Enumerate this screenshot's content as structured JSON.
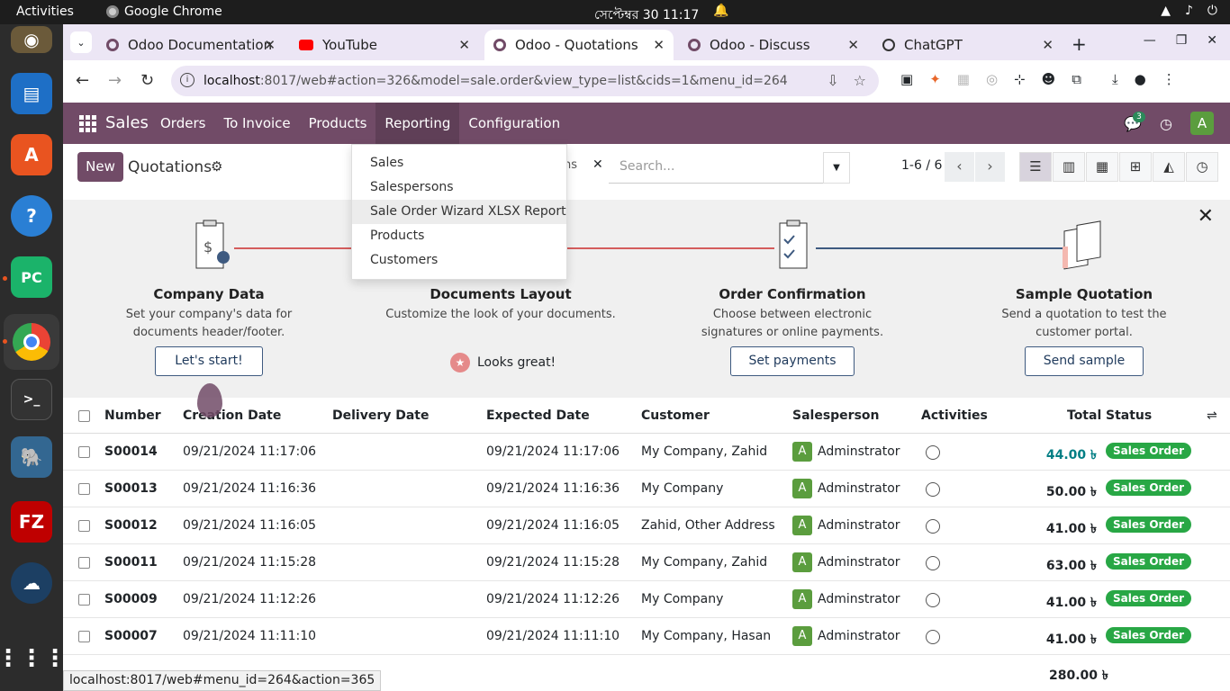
{
  "system": {
    "activities": "Activities",
    "app": "Google Chrome",
    "clock": "সেপ্টেম্বর 30  11:17"
  },
  "tabs": [
    {
      "title": "Odoo Documentation",
      "active": false
    },
    {
      "title": "YouTube",
      "active": false
    },
    {
      "title": "Odoo - Quotations",
      "active": true
    },
    {
      "title": "Odoo - Discuss",
      "active": false
    },
    {
      "title": "ChatGPT",
      "active": false
    }
  ],
  "url": {
    "host": "localhost",
    "path": ":8017/web#action=326&model=sale.order&view_type=list&cids=1&menu_id=264"
  },
  "odoo": {
    "brand": "Sales",
    "menu": [
      "Orders",
      "To Invoice",
      "Products",
      "Reporting",
      "Configuration"
    ],
    "chat_count": "3",
    "avatar": "A"
  },
  "control": {
    "new": "New",
    "title": "Quotations",
    "facet": "ons",
    "search_placeholder": "Search...",
    "pager": "1-6 / 6"
  },
  "reporting_menu": [
    "Sales",
    "Salespersons",
    "Sale Order Wizard XLSX Report",
    "Products",
    "Customers"
  ],
  "onboarding": [
    {
      "title": "Company Data",
      "desc": "Set your company's data for documents header/footer.",
      "button": "Let's start!"
    },
    {
      "title": "Documents Layout",
      "desc": "Customize the look of your documents.",
      "done": "Looks great!"
    },
    {
      "title": "Order Confirmation",
      "desc": "Choose between electronic signatures or online payments.",
      "button": "Set payments"
    },
    {
      "title": "Sample Quotation",
      "desc": "Send a quotation to test the customer portal.",
      "button": "Send sample"
    }
  ],
  "columns": [
    "Number",
    "Creation Date",
    "Delivery Date",
    "Expected Date",
    "Customer",
    "Salesperson",
    "Activities",
    "Total",
    "Status"
  ],
  "rows": [
    {
      "number": "S00014",
      "created": "09/21/2024 11:17:06",
      "expected": "09/21/2024 11:17:06",
      "customer": "My Company, Zahid",
      "salesperson": "Adminstrator",
      "total": "44.00 ৳",
      "status": "Sales Order"
    },
    {
      "number": "S00013",
      "created": "09/21/2024 11:16:36",
      "expected": "09/21/2024 11:16:36",
      "customer": "My Company",
      "salesperson": "Adminstrator",
      "total": "50.00 ৳",
      "status": "Sales Order"
    },
    {
      "number": "S00012",
      "created": "09/21/2024 11:16:05",
      "expected": "09/21/2024 11:16:05",
      "customer": "Zahid, Other Address",
      "salesperson": "Adminstrator",
      "total": "41.00 ৳",
      "status": "Sales Order"
    },
    {
      "number": "S00011",
      "created": "09/21/2024 11:15:28",
      "expected": "09/21/2024 11:15:28",
      "customer": "My Company, Zahid",
      "salesperson": "Adminstrator",
      "total": "63.00 ৳",
      "status": "Sales Order"
    },
    {
      "number": "S00009",
      "created": "09/21/2024 11:12:26",
      "expected": "09/21/2024 11:12:26",
      "customer": "My Company",
      "salesperson": "Adminstrator",
      "total": "41.00 ৳",
      "status": "Sales Order"
    },
    {
      "number": "S00007",
      "created": "09/21/2024 11:11:10",
      "expected": "09/21/2024 11:11:10",
      "customer": "My Company, Hasan",
      "salesperson": "Adminstrator",
      "total": "41.00 ৳",
      "status": "Sales Order"
    }
  ],
  "sum": "280.00 ৳",
  "status_url": "localhost:8017/web#menu_id=264&action=365"
}
